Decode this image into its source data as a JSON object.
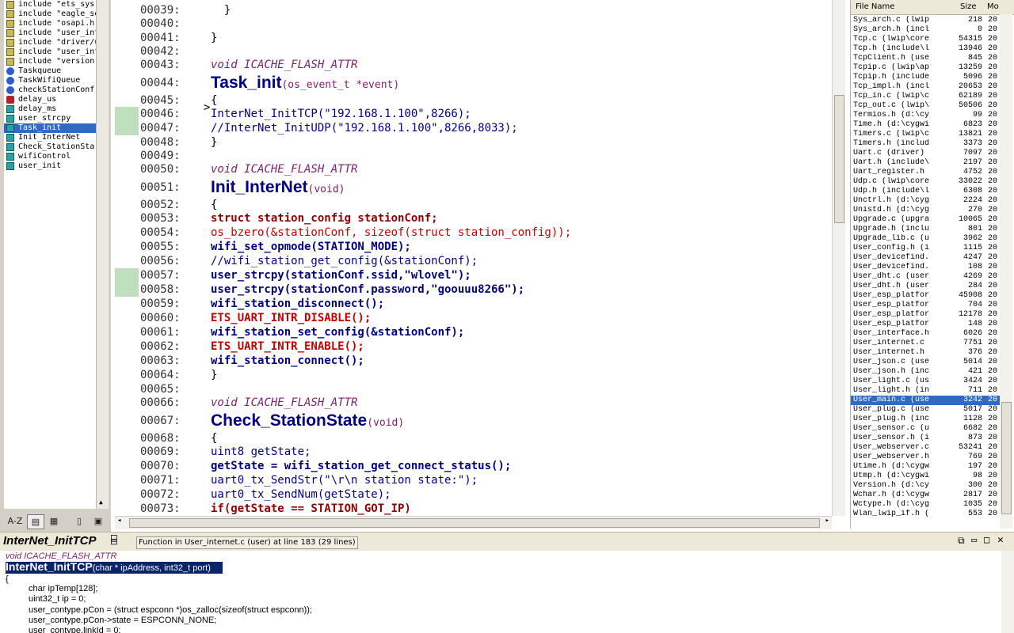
{
  "symbols": [
    {
      "label": "include \"ets_sys.",
      "kind": "include"
    },
    {
      "label": "include \"eagle_so",
      "kind": "include"
    },
    {
      "label": "include \"osapi.h\"",
      "kind": "include"
    },
    {
      "label": "include \"user_int",
      "kind": "include"
    },
    {
      "label": "include \"driver/u",
      "kind": "include"
    },
    {
      "label": "include \"user_int",
      "kind": "include"
    },
    {
      "label": "include \"version.",
      "kind": "include"
    },
    {
      "label": "Taskqueue",
      "kind": "var"
    },
    {
      "label": "TaskWifiQueue",
      "kind": "var"
    },
    {
      "label": "checkStationConf",
      "kind": "var"
    },
    {
      "label": "delay_us",
      "kind": "define"
    },
    {
      "label": "delay_ms",
      "kind": "func"
    },
    {
      "label": "user_strcpy",
      "kind": "func"
    },
    {
      "label": "Task_init",
      "kind": "func",
      "selected": true
    },
    {
      "label": "Init_InterNet",
      "kind": "func"
    },
    {
      "label": "Check_StationSta",
      "kind": "func"
    },
    {
      "label": "wifiControl",
      "kind": "func"
    },
    {
      "label": "user_init",
      "kind": "func"
    }
  ],
  "toolbar": {
    "az_label": "A-Z"
  },
  "editor": {
    "line_numbers": [
      "00039:",
      "00040:",
      "00041:",
      "00042:",
      "00043:",
      "00044:",
      "00045:",
      "00046:",
      "00047:",
      "00048:",
      "00049:",
      "00050:",
      "00051:",
      "00052:",
      "00053:",
      "00054:",
      "00055:",
      "00056:",
      "00057:",
      "00058:",
      "00059:",
      "00060:",
      "00061:",
      "00062:",
      "00063:",
      "00064:",
      "00065:",
      "00066:",
      "00067:",
      "00068:",
      "00069:",
      "00070:",
      "00071:",
      "00072:",
      "00073:"
    ],
    "attr": "void ICACHE_FLASH_ATTR",
    "task_init": {
      "name": "Task_init",
      "params": "(os_event_t *event)"
    },
    "tcp_call": "InterNet_InitTCP(\"192.168.1.100\",8266);",
    "udp_comment": "//InterNet_InitUDP(\"192.168.1.100\",8266,8033);",
    "init_internet": {
      "name": "Init_InterNet",
      "params": "(void)"
    },
    "l53": "struct station_config stationConf;",
    "l54": "os_bzero(&stationConf, sizeof(struct station_config));",
    "l55": "wifi_set_opmode(STATION_MODE);",
    "l56": "//wifi_station_get_config(&stationConf);",
    "l57": "user_strcpy(stationConf.ssid,\"wlovel\");",
    "l58": "user_strcpy(stationConf.password,\"goouuu8266\");",
    "l59": "wifi_station_disconnect();",
    "l60": "ETS_UART_INTR_DISABLE();",
    "l61": "wifi_station_set_config(&stationConf);",
    "l62": "ETS_UART_INTR_ENABLE();",
    "l63": "wifi_station_connect();",
    "check_station": {
      "name": "Check_StationState",
      "params": "(void)"
    },
    "l69": "uint8 getState;",
    "l70": "getState = wifi_station_get_connect_status();",
    "l71": "uart0_tx_SendStr(\"\\r\\n station state:\");",
    "l72": "uart0_tx_SendNum(getState);",
    "l73": "if(getState == STATION_GOT_IP)",
    "brace_open": "{",
    "brace_close": "}",
    "brace_close_indent": "  }"
  },
  "file_panel": {
    "header": {
      "name": "File Name",
      "size": "Size",
      "mod": "Mo"
    },
    "files": [
      {
        "name": "Sys_arch.c (lwip",
        "size": "218",
        "mod": "20"
      },
      {
        "name": "Sys_arch.h (incl",
        "size": "0",
        "mod": "20"
      },
      {
        "name": "Tcp.c (lwip\\core",
        "size": "54315",
        "mod": "20"
      },
      {
        "name": "Tcp.h (include\\l",
        "size": "13946",
        "mod": "20"
      },
      {
        "name": "TcpClient.h (use",
        "size": "845",
        "mod": "20"
      },
      {
        "name": "Tcpip.c (lwip\\ap",
        "size": "13259",
        "mod": "20"
      },
      {
        "name": "Tcpip.h (include",
        "size": "5096",
        "mod": "20"
      },
      {
        "name": "Tcp_impl.h (incl",
        "size": "20653",
        "mod": "20"
      },
      {
        "name": "Tcp_in.c (lwip\\c",
        "size": "62189",
        "mod": "20"
      },
      {
        "name": "Tcp_out.c (lwip\\",
        "size": "50506",
        "mod": "20"
      },
      {
        "name": "Termios.h (d:\\cy",
        "size": "99",
        "mod": "20"
      },
      {
        "name": "Time.h (d:\\cygwi",
        "size": "6823",
        "mod": "20"
      },
      {
        "name": "Timers.c (lwip\\c",
        "size": "13821",
        "mod": "20"
      },
      {
        "name": "Timers.h (includ",
        "size": "3373",
        "mod": "20"
      },
      {
        "name": "Uart.c (driver)",
        "size": "7097",
        "mod": "20"
      },
      {
        "name": "Uart.h (include\\",
        "size": "2197",
        "mod": "20"
      },
      {
        "name": "Uart_register.h",
        "size": "4752",
        "mod": "20"
      },
      {
        "name": "Udp.c (lwip\\core",
        "size": "33022",
        "mod": "20"
      },
      {
        "name": "Udp.h (include\\l",
        "size": "6308",
        "mod": "20"
      },
      {
        "name": "Unctrl.h (d:\\cyg",
        "size": "2224",
        "mod": "20"
      },
      {
        "name": "Unistd.h (d:\\cyg",
        "size": "270",
        "mod": "20"
      },
      {
        "name": "Upgrade.c (upgra",
        "size": "10065",
        "mod": "20"
      },
      {
        "name": "Upgrade.h (inclu",
        "size": "801",
        "mod": "20"
      },
      {
        "name": "Upgrade_lib.c (u",
        "size": "3962",
        "mod": "20"
      },
      {
        "name": "User_config.h (i",
        "size": "1115",
        "mod": "20"
      },
      {
        "name": "User_devicefind.",
        "size": "4247",
        "mod": "20"
      },
      {
        "name": "User_devicefind.",
        "size": "108",
        "mod": "20"
      },
      {
        "name": "User_dht.c (user",
        "size": "4269",
        "mod": "20"
      },
      {
        "name": "User_dht.h (user",
        "size": "284",
        "mod": "20"
      },
      {
        "name": "User_esp_platfor",
        "size": "45908",
        "mod": "20"
      },
      {
        "name": "User_esp_platfor",
        "size": "704",
        "mod": "20"
      },
      {
        "name": "User_esp_platfor",
        "size": "12178",
        "mod": "20"
      },
      {
        "name": "User_esp_platfor",
        "size": "148",
        "mod": "20"
      },
      {
        "name": "User_interface.h",
        "size": "6026",
        "mod": "20"
      },
      {
        "name": "User_internet.c",
        "size": "7751",
        "mod": "20"
      },
      {
        "name": "User_internet.h",
        "size": "376",
        "mod": "20"
      },
      {
        "name": "User_json.c (use",
        "size": "5014",
        "mod": "20"
      },
      {
        "name": "User_json.h (inc",
        "size": "421",
        "mod": "20"
      },
      {
        "name": "User_light.c (us",
        "size": "3424",
        "mod": "20"
      },
      {
        "name": "User_light.h (in",
        "size": "711",
        "mod": "20"
      },
      {
        "name": "User_main.c (use",
        "size": "3242",
        "mod": "20",
        "selected": true
      },
      {
        "name": "User_plug.c (use",
        "size": "5017",
        "mod": "20"
      },
      {
        "name": "User_plug.h (inc",
        "size": "1128",
        "mod": "20"
      },
      {
        "name": "User_sensor.c (u",
        "size": "6682",
        "mod": "20"
      },
      {
        "name": "User_sensor.h (i",
        "size": "873",
        "mod": "20"
      },
      {
        "name": "User_webserver.c",
        "size": "53241",
        "mod": "20"
      },
      {
        "name": "User_webserver.h",
        "size": "769",
        "mod": "20"
      },
      {
        "name": "Utime.h (d:\\cygw",
        "size": "197",
        "mod": "20"
      },
      {
        "name": "Utmp.h (d:\\cygwi",
        "size": "98",
        "mod": "20"
      },
      {
        "name": "Version.h (d:\\cy",
        "size": "300",
        "mod": "20"
      },
      {
        "name": "Wchar.h (d:\\cygw",
        "size": "2817",
        "mod": "20"
      },
      {
        "name": "Wctype.h (d:\\cyg",
        "size": "1035",
        "mod": "20"
      },
      {
        "name": "Wlan_lwip_if.h (",
        "size": "553",
        "mod": "20"
      }
    ]
  },
  "context": {
    "title": "InterNet_InitTCP",
    "info": "Function in User_internet.c (user) at line 183 (29 lines)",
    "attr": "void ICACHE_FLASH_ATTR",
    "decl_name": "InterNet_InitTCP",
    "decl_params": "(char * ipAddress, int32_t port)",
    "l1": "{",
    "l2": "char ipTemp[128];",
    "l3": "uint32_t ip = 0;",
    "l4": "user_contype.pCon = (struct espconn *)os_zalloc(sizeof(struct espconn));",
    "l5": "user_contype.pCon->state = ESPCONN_NONE;",
    "l6": "user_contype.linkId = 0;"
  }
}
